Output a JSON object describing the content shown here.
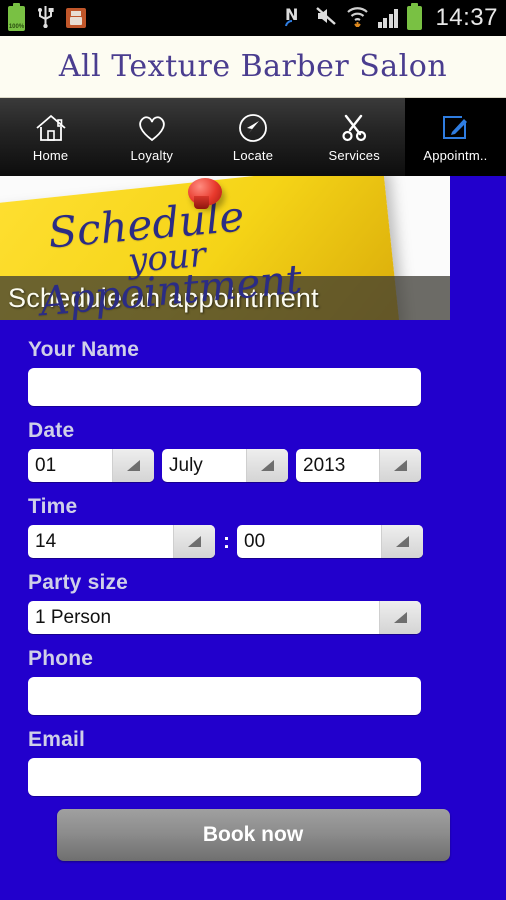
{
  "statusbar": {
    "battery_percent_label": "100%",
    "clock": "14:37",
    "icons_left": [
      "battery-icon",
      "usb-icon",
      "sdcard-icon"
    ],
    "icons_right": [
      "nfc-icon",
      "mute-icon",
      "wifi-icon",
      "signal-icon",
      "battery-icon"
    ]
  },
  "header": {
    "title": "All Texture Barber Salon"
  },
  "nav": {
    "items": [
      {
        "label": "Home",
        "icon": "home-icon",
        "active": false
      },
      {
        "label": "Loyalty",
        "icon": "heart-icon",
        "active": false
      },
      {
        "label": "Locate",
        "icon": "navigation-icon",
        "active": false
      },
      {
        "label": "Services",
        "icon": "scissors-icon",
        "active": false
      },
      {
        "label": "Appointm..",
        "icon": "edit-square-icon",
        "active": true
      }
    ],
    "active_color": "#2f7de1"
  },
  "hero": {
    "caption": "Schedule an appointment",
    "note_line1": "Schedule",
    "note_line2": "your",
    "note_line3": "Appointment",
    "note_color": "#f2cf16",
    "pin_color": "#e8392c"
  },
  "form": {
    "name": {
      "label": "Your Name",
      "value": "",
      "placeholder": ""
    },
    "date": {
      "label": "Date",
      "day": "01",
      "month": "July",
      "year": "2013"
    },
    "time": {
      "label": "Time",
      "hour": "14",
      "separator": ":",
      "minute": "00"
    },
    "party": {
      "label": "Party size",
      "value": "1 Person"
    },
    "phone": {
      "label": "Phone",
      "value": "",
      "placeholder": ""
    },
    "email": {
      "label": "Email",
      "value": "",
      "placeholder": ""
    },
    "submit_label": "Book now"
  },
  "colors": {
    "page_background": "#2200cc",
    "label_text": "#cfcfe8",
    "title_text": "#4a3d8f",
    "titlebar_background": "#fdfcf2"
  }
}
